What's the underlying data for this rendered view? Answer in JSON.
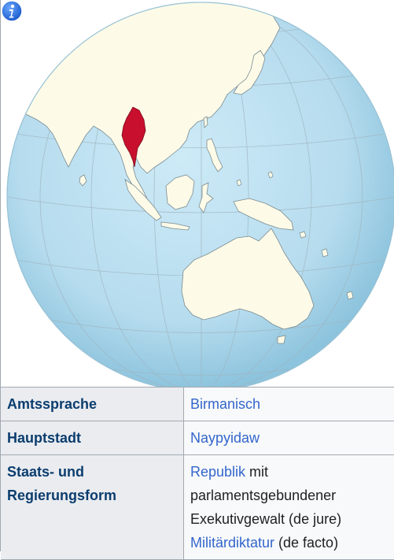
{
  "map": {
    "highlighted_country": "Myanmar",
    "highlight_color": "#c8102e",
    "ocean_color": "#b9dff0",
    "land_color": "#fdfbe8",
    "info_icon": "info-icon"
  },
  "rows": [
    {
      "label": "Amtssprache",
      "value": "Birmanisch"
    },
    {
      "label": "Hauptstadt",
      "value": "Naypyidaw"
    }
  ],
  "government": {
    "label_line1": "Staats- und",
    "label_line2": "Regierungsform",
    "republik_link": "Republik",
    "text_after_republik": " mit",
    "line2": "parlamentsgebundener",
    "line3": "Exekutivgewalt (de jure)",
    "militaer_link": "Militärdiktatur",
    "text_after_militaer": " (de facto)"
  }
}
